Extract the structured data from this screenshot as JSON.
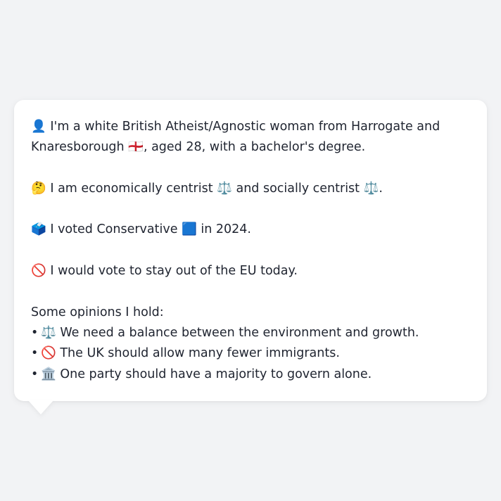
{
  "profile": {
    "intro": "👤 I'm a white British Atheist/Agnostic woman from Harrogate and Knaresborough 🏴󠁧󠁢󠁥󠁮󠁧󠁿, aged 28, with a bachelor's degree.",
    "ideology": "🤔 I am economically centrist ⚖️ and socially centrist ⚖️.",
    "vote": "🗳️ I voted Conservative 🟦 in 2024.",
    "eu": "🚫 I would vote to stay out of the EU today.",
    "opinions_heading": "Some opinions I hold:",
    "opinions": [
      "⚖️ We need a balance between the environment and growth.",
      "🚫 The UK should allow many fewer immigrants.",
      "🏛️ One party should have a majority to govern alone."
    ],
    "bullet_char": "•"
  }
}
